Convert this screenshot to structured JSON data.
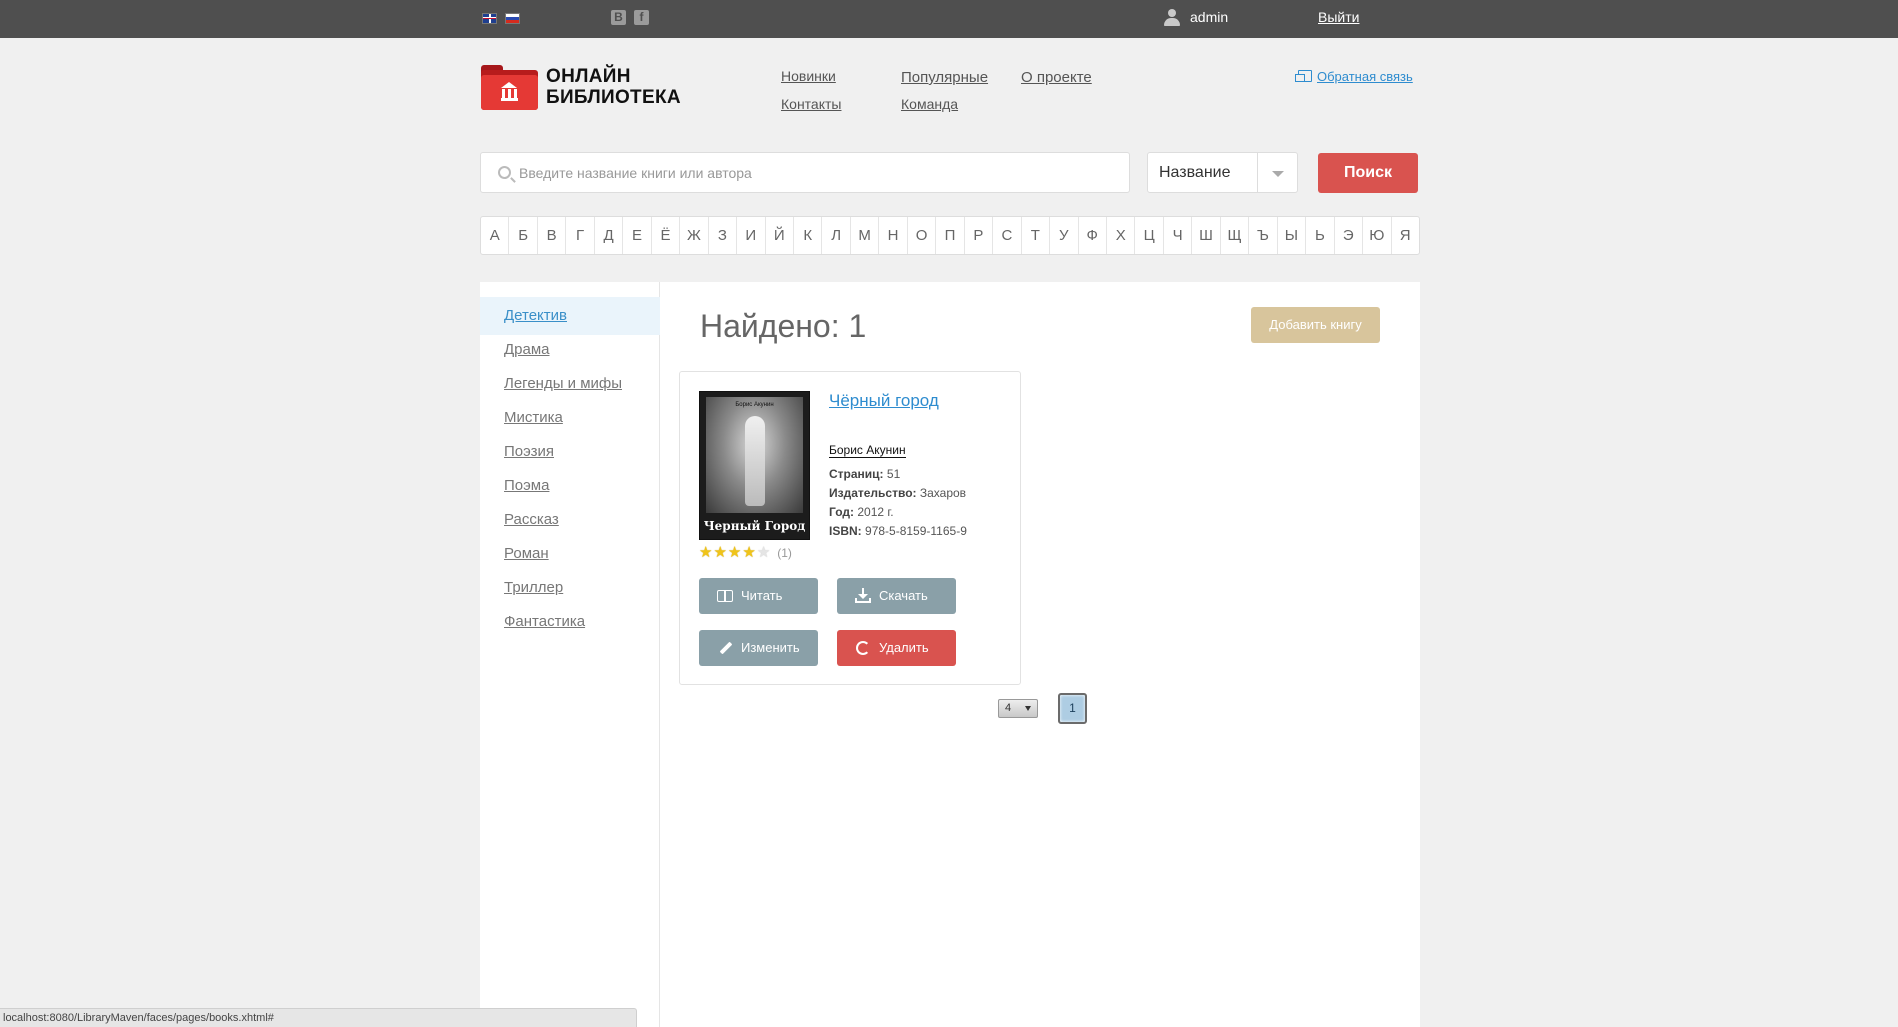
{
  "topbar": {
    "lang_en": "English",
    "lang_ru": "Русский",
    "vk": "В",
    "fb": "f",
    "username": "admin",
    "logout": "Выйти"
  },
  "header": {
    "logo_line1": "ОНЛАЙН",
    "logo_line2": "БИБЛИОТЕКА",
    "nav": {
      "new": "Новинки",
      "contacts": "Контакты",
      "popular": "Популярные",
      "team": "Команда",
      "about": "О проекте"
    },
    "feedback": "Обратная связь"
  },
  "search": {
    "placeholder": "Введите название книги или автора",
    "value": "",
    "type_selected": "Название",
    "button": "Поиск"
  },
  "alphabet": [
    "А",
    "Б",
    "В",
    "Г",
    "Д",
    "Е",
    "Ё",
    "Ж",
    "З",
    "И",
    "Й",
    "К",
    "Л",
    "М",
    "Н",
    "О",
    "П",
    "Р",
    "С",
    "Т",
    "У",
    "Ф",
    "Х",
    "Ц",
    "Ч",
    "Ш",
    "Щ",
    "Ъ",
    "Ы",
    "Ь",
    "Э",
    "Ю",
    "Я"
  ],
  "genres": [
    {
      "label": "Детектив",
      "active": true
    },
    {
      "label": "Драма",
      "active": false
    },
    {
      "label": "Легенды и мифы",
      "active": false
    },
    {
      "label": "Мистика",
      "active": false
    },
    {
      "label": "Поэзия",
      "active": false
    },
    {
      "label": "Поэма",
      "active": false
    },
    {
      "label": "Рассказ",
      "active": false
    },
    {
      "label": "Роман",
      "active": false
    },
    {
      "label": "Триллер",
      "active": false
    },
    {
      "label": "Фантастика",
      "active": false
    }
  ],
  "results": {
    "found_label": "Найдено: 1",
    "add_book": "Добавить книгу"
  },
  "book": {
    "title": "Чёрный город",
    "author": "Борис Акунин",
    "cover_author": "Борис Акунин",
    "cover_title": "Черный Город",
    "rating": 4,
    "rating_max": 5,
    "votes": "(1)",
    "pages_label": "Страниц:",
    "pages": "51",
    "publisher_label": "Издательство:",
    "publisher": "Захаров",
    "year_label": "Год:",
    "year": "2012 г.",
    "isbn_label": "ISBN:",
    "isbn": "978-5-8159-1165-9",
    "read": "Читать",
    "download": "Скачать",
    "edit": "Изменить",
    "delete": "Удалить"
  },
  "pagination": {
    "rows_per_page": "4",
    "current_page": "1"
  },
  "statusbar": {
    "url": "localhost:8080/LibraryMaven/faces/pages/books.xhtml#"
  },
  "colors": {
    "topbar": "#4f4f4f",
    "accent_red": "#d9534f",
    "link_blue": "#2e8ccf",
    "add_button": "#d8c59c",
    "action_gray": "#8aa0a8"
  }
}
